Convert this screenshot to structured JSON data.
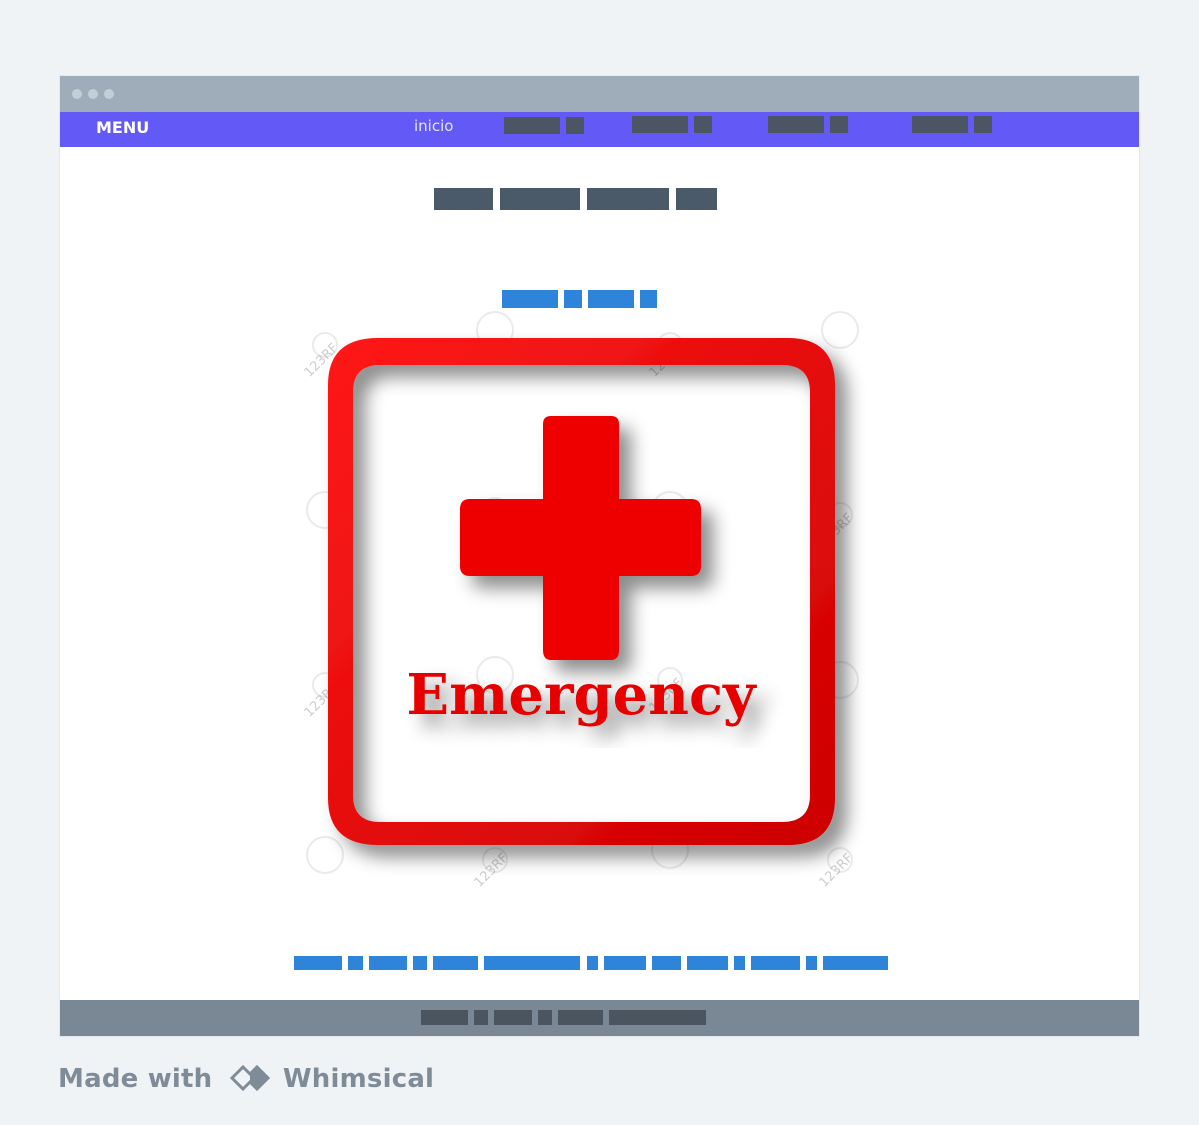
{
  "navbar": {
    "menu_label": "MENU",
    "inicio_label": "inicio",
    "placeholder_items": 4
  },
  "hero": {
    "image_label": "Emergency",
    "watermark_text": "123RF"
  },
  "colors": {
    "nav_bg": "#6359f6",
    "titlebar_bg": "#9eadb9",
    "footer_bg": "#7a8896",
    "emergency_red": "#e60000",
    "link_blue": "#2d84d8",
    "page_bg": "#f0f3f6"
  },
  "branding": {
    "made_with": "Made with",
    "brand": "Whimsical"
  }
}
